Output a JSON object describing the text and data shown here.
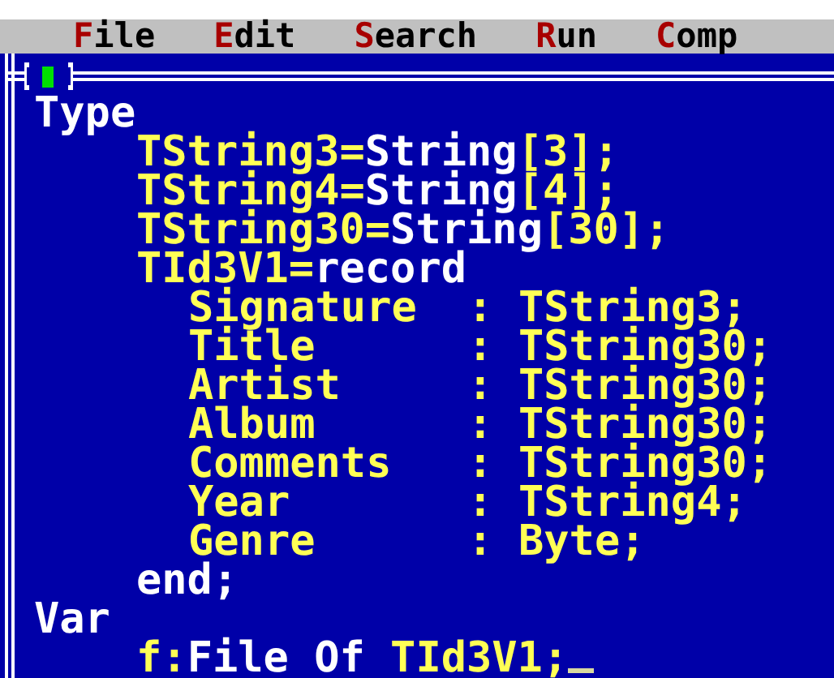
{
  "menu_bar": {
    "items": [
      {
        "label": "File"
      },
      {
        "label": "Edit"
      },
      {
        "label": "Search"
      },
      {
        "label": "Run"
      },
      {
        "label": "Comp"
      }
    ]
  },
  "editor": {
    "lines": [
      {
        "segments": [
          {
            "text": "Type",
            "kind": "keyword"
          }
        ],
        "children": [
          {
            "segments": [
              {
                "text": "TString3=",
                "kind": "ident"
              },
              {
                "text": "String",
                "kind": "keyword"
              },
              {
                "text": "[3];",
                "kind": "ident"
              }
            ]
          },
          {
            "segments": [
              {
                "text": "TString4=",
                "kind": "ident"
              },
              {
                "text": "String",
                "kind": "keyword"
              },
              {
                "text": "[4];",
                "kind": "ident"
              }
            ]
          },
          {
            "segments": [
              {
                "text": "TString30=",
                "kind": "ident"
              },
              {
                "text": "String",
                "kind": "keyword"
              },
              {
                "text": "[30];",
                "kind": "ident"
              }
            ]
          },
          {
            "segments": [
              {
                "text": "TId3V1=",
                "kind": "ident"
              },
              {
                "text": "record",
                "kind": "keyword"
              }
            ],
            "children": [
              {
                "segments": [
                  {
                    "text": "Signature  : TString3;",
                    "kind": "ident"
                  }
                ]
              },
              {
                "segments": [
                  {
                    "text": "Title      : TString30;",
                    "kind": "ident"
                  }
                ]
              },
              {
                "segments": [
                  {
                    "text": "Artist     : TString30;",
                    "kind": "ident"
                  }
                ]
              },
              {
                "segments": [
                  {
                    "text": "Album      : TString30;",
                    "kind": "ident"
                  }
                ]
              },
              {
                "segments": [
                  {
                    "text": "Comments   : TString30;",
                    "kind": "ident"
                  }
                ]
              },
              {
                "segments": [
                  {
                    "text": "Year       : TString4;",
                    "kind": "ident"
                  }
                ]
              },
              {
                "segments": [
                  {
                    "text": "Genre      : Byte;",
                    "kind": "ident"
                  }
                ]
              }
            ]
          },
          {
            "segments": [
              {
                "text": "end;",
                "kind": "keyword"
              }
            ]
          }
        ]
      },
      {
        "segments": [
          {
            "text": "Var",
            "kind": "keyword"
          }
        ],
        "children": [
          {
            "segments": [
              {
                "text": "f:",
                "kind": "ident"
              },
              {
                "text": "File Of",
                "kind": "keyword"
              },
              {
                "text": " TId3V1;",
                "kind": "ident"
              }
            ]
          }
        ]
      }
    ]
  }
}
